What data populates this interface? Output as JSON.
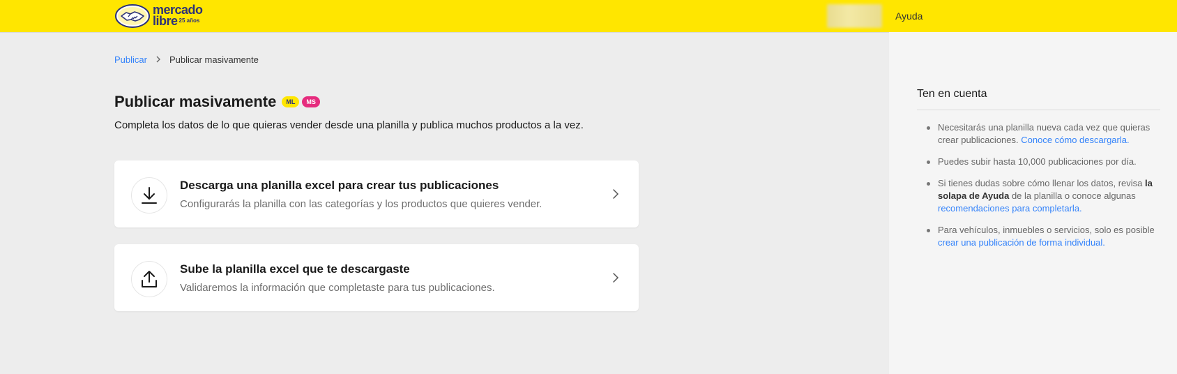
{
  "header": {
    "logo": {
      "line1": "mercado",
      "line2": "libre",
      "tagline": "25 años"
    },
    "help_label": "Ayuda"
  },
  "breadcrumb": {
    "parent": "Publicar",
    "current": "Publicar masivamente"
  },
  "page": {
    "title": "Publicar masivamente",
    "badges": [
      "ML",
      "MS"
    ],
    "subtitle": "Completa los datos de lo que quieras vender desde una planilla y publica muchos productos a la vez."
  },
  "cards": [
    {
      "title": "Descarga una planilla excel para crear tus publicaciones",
      "description": "Configurarás la planilla con las categorías y los productos que quieres vender.",
      "icon": "download-icon"
    },
    {
      "title": "Sube la planilla excel que te descargaste",
      "description": "Validaremos la información que completaste para tus publicaciones.",
      "icon": "upload-icon"
    }
  ],
  "sidebar": {
    "title": "Ten en cuenta",
    "tips": [
      {
        "text": "Necesitarás una planilla nueva cada vez que quieras crear publicaciones. ",
        "link": "Conoce cómo descargarla."
      },
      {
        "text": "Puedes subir hasta 10,000 publicaciones por día."
      },
      {
        "text_before": "Si tienes dudas sobre cómo llenar los datos, revisa ",
        "bold": "la solapa de Ayuda",
        "text_after": " de la planilla o conoce algunas ",
        "link": "recomendaciones para completarla."
      },
      {
        "text": "Para vehículos, inmuebles o servicios, solo es posible ",
        "link": "crear una publicación de forma individual."
      }
    ]
  },
  "colors": {
    "brand_yellow": "#ffe600",
    "brand_blue": "#2d3277",
    "link_blue": "#3483fa",
    "badge_pink": "#e62c7e",
    "background": "#ededed"
  }
}
